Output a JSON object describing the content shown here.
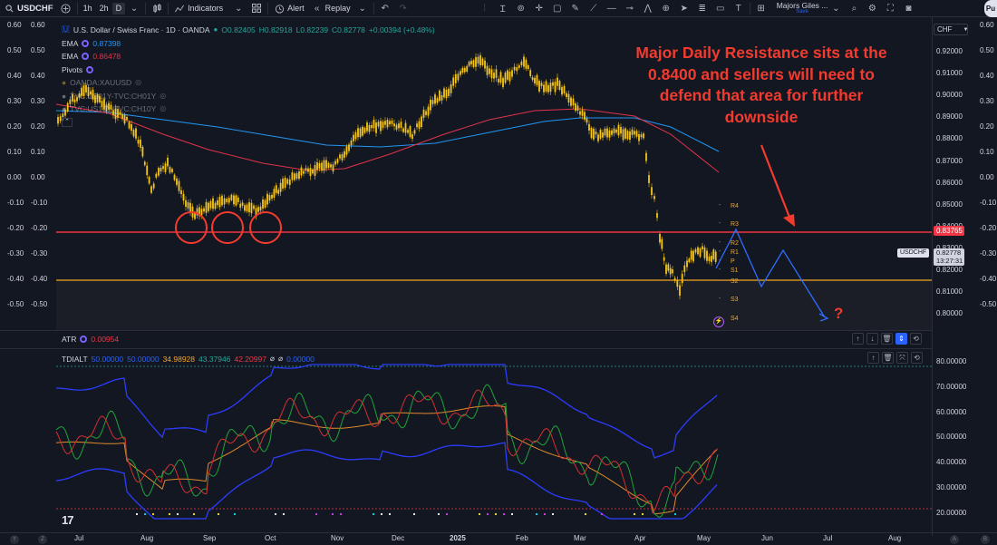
{
  "toolbar": {
    "symbol": "USDCHF",
    "intervals": [
      "1h",
      "2h",
      "D"
    ],
    "indicators_label": "Indicators",
    "alert_label": "Alert",
    "replay_label": "Replay",
    "layout_name": "Majors Giles ...",
    "layout_sub": "Save",
    "publish_label": "Pu"
  },
  "legend": {
    "title": "U.S. Dollar / Swiss Franc · 1D · OANDA",
    "open": "O0.82405",
    "high": "H0.82918",
    "low": "L0.82239",
    "close": "C0.82778",
    "change": "+0.00394 (+0.48%)",
    "ema1_label": "EMA",
    "ema1_value": "0.87398",
    "ema2_label": "EMA",
    "ema2_value": "0.86478",
    "pivots_label": "Pivots",
    "overlay1": "OANDA:XAUUSD",
    "overlay2": "TVC:US01Y-TVC:CH01Y",
    "overlay3": "TVC:US10Y-TVC:CH10Y"
  },
  "annotation": "Major Daily Resistance sits at the 0.8400 and sellers will need to defend that area for further downside",
  "question_mark": "?",
  "pivots": [
    "R4",
    "R3",
    "R2",
    "R1",
    "P",
    "S1",
    "S2",
    "S3",
    "S4"
  ],
  "right_scale": {
    "currency": "CHF",
    "labels": [
      "0.92000",
      "0.91000",
      "0.90000",
      "0.89000",
      "0.88000",
      "0.87000",
      "0.86000",
      "0.85000",
      "0.84000",
      "0.83000",
      "0.82000",
      "0.81000",
      "0.80000"
    ],
    "resistance_tag": "0.83765",
    "current_symbol": "USDCHF",
    "current_price": "0.82778",
    "countdown": "13:27:31",
    "tdi_labels": [
      "80.00000",
      "70.00000",
      "60.00000",
      "50.00000",
      "40.00000",
      "30.00000",
      "20.00000"
    ],
    "far_labels": [
      "0.60",
      "0.50",
      "0.40",
      "0.30",
      "0.20",
      "0.10",
      "0.00",
      "-0.10",
      "-0.20",
      "-0.30",
      "-0.40",
      "-0.50"
    ]
  },
  "left_scale": [
    "0.60",
    "0.50",
    "0.40",
    "0.30",
    "0.20",
    "0.10",
    "0.00",
    "-0.10",
    "-0.20",
    "-0.30",
    "-0.40",
    "-0.50"
  ],
  "atr": {
    "label": "ATR",
    "value": "0.00954"
  },
  "tdi": {
    "label": "TDIALT",
    "v1": "50.00000",
    "v2": "50.00000",
    "v3": "34.98928",
    "v4": "43.37946",
    "v5": "42.20997",
    "v6": "0.00000"
  },
  "time_axis": [
    {
      "label": "Jul",
      "bold": false
    },
    {
      "label": "Aug",
      "bold": false
    },
    {
      "label": "Sep",
      "bold": false
    },
    {
      "label": "Oct",
      "bold": false
    },
    {
      "label": "Nov",
      "bold": false
    },
    {
      "label": "Dec",
      "bold": false
    },
    {
      "label": "2025",
      "bold": true
    },
    {
      "label": "Feb",
      "bold": false
    },
    {
      "label": "Mar",
      "bold": false
    },
    {
      "label": "Apr",
      "bold": false
    },
    {
      "label": "May",
      "bold": false
    },
    {
      "label": "Jun",
      "bold": false
    },
    {
      "label": "Jul",
      "bold": false
    },
    {
      "label": "Aug",
      "bold": false
    }
  ],
  "colors": {
    "background": "#131722",
    "candles": "#f5c518",
    "ema_fast": "#2196f3",
    "ema_slow": "#e0334a",
    "resistance": "#f23645",
    "support": "#f5a623",
    "annotation": "#f23b2e",
    "projection": "#2962ff"
  }
}
